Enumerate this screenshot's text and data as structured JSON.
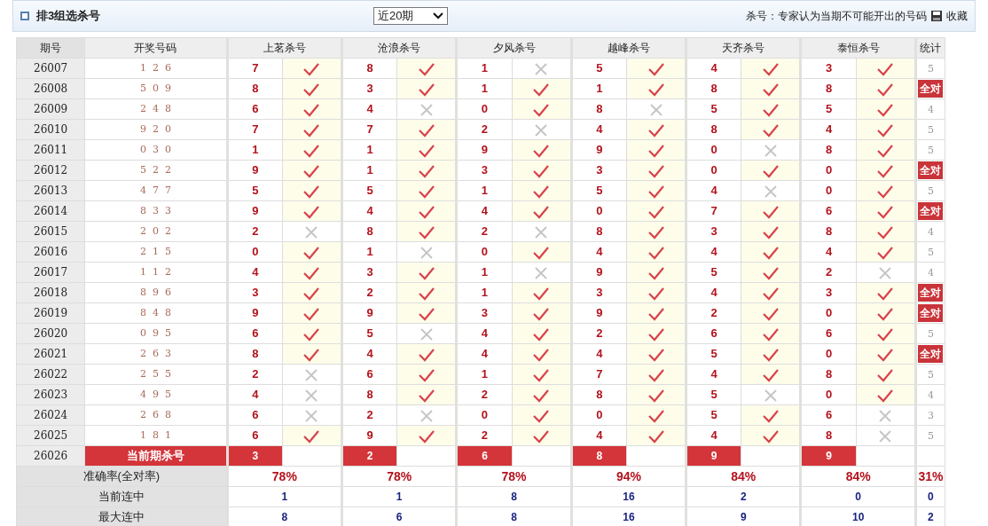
{
  "header": {
    "title": "排3组选杀号",
    "period_select": "近20期",
    "note": "杀号：专家认为当期不可能开出的号码",
    "save": "收藏"
  },
  "columns": {
    "period": "期号",
    "draw": "开奖号码",
    "experts": [
      "上茗杀号",
      "沧浪杀号",
      "夕风杀号",
      "越峰杀号",
      "天齐杀号",
      "泰恒杀号"
    ],
    "stat": "统计"
  },
  "rows": [
    {
      "period": "26007",
      "draw": "1 2 6",
      "picks": [
        {
          "num": "7",
          "hit": true
        },
        {
          "num": "8",
          "hit": true
        },
        {
          "num": "1",
          "hit": false
        },
        {
          "num": "5",
          "hit": true
        },
        {
          "num": "4",
          "hit": true
        },
        {
          "num": "3",
          "hit": true
        }
      ],
      "stat": {
        "kind": "count",
        "text": "5"
      }
    },
    {
      "period": "26008",
      "draw": "5 0 9",
      "picks": [
        {
          "num": "8",
          "hit": true
        },
        {
          "num": "3",
          "hit": true
        },
        {
          "num": "1",
          "hit": true
        },
        {
          "num": "1",
          "hit": true
        },
        {
          "num": "8",
          "hit": true
        },
        {
          "num": "8",
          "hit": true
        }
      ],
      "stat": {
        "kind": "all",
        "text": "全对"
      }
    },
    {
      "period": "26009",
      "draw": "2 4 8",
      "picks": [
        {
          "num": "6",
          "hit": true
        },
        {
          "num": "4",
          "hit": false
        },
        {
          "num": "0",
          "hit": true
        },
        {
          "num": "8",
          "hit": false
        },
        {
          "num": "5",
          "hit": true
        },
        {
          "num": "5",
          "hit": true
        }
      ],
      "stat": {
        "kind": "count",
        "text": "4"
      }
    },
    {
      "period": "26010",
      "draw": "9 2 0",
      "picks": [
        {
          "num": "7",
          "hit": true
        },
        {
          "num": "7",
          "hit": true
        },
        {
          "num": "2",
          "hit": false
        },
        {
          "num": "4",
          "hit": true
        },
        {
          "num": "8",
          "hit": true
        },
        {
          "num": "4",
          "hit": true
        }
      ],
      "stat": {
        "kind": "count",
        "text": "5"
      }
    },
    {
      "period": "26011",
      "draw": "0 3 0",
      "picks": [
        {
          "num": "1",
          "hit": true
        },
        {
          "num": "1",
          "hit": true
        },
        {
          "num": "9",
          "hit": true
        },
        {
          "num": "9",
          "hit": true
        },
        {
          "num": "0",
          "hit": false
        },
        {
          "num": "8",
          "hit": true
        }
      ],
      "stat": {
        "kind": "count",
        "text": "5"
      }
    },
    {
      "period": "26012",
      "draw": "5 2 2",
      "picks": [
        {
          "num": "9",
          "hit": true
        },
        {
          "num": "1",
          "hit": true
        },
        {
          "num": "3",
          "hit": true
        },
        {
          "num": "3",
          "hit": true
        },
        {
          "num": "0",
          "hit": true
        },
        {
          "num": "0",
          "hit": true
        }
      ],
      "stat": {
        "kind": "all",
        "text": "全对"
      }
    },
    {
      "period": "26013",
      "draw": "4 7 7",
      "picks": [
        {
          "num": "5",
          "hit": true
        },
        {
          "num": "5",
          "hit": true
        },
        {
          "num": "1",
          "hit": true
        },
        {
          "num": "5",
          "hit": true
        },
        {
          "num": "4",
          "hit": false
        },
        {
          "num": "0",
          "hit": true
        }
      ],
      "stat": {
        "kind": "count",
        "text": "5"
      }
    },
    {
      "period": "26014",
      "draw": "8 3 3",
      "picks": [
        {
          "num": "9",
          "hit": true
        },
        {
          "num": "4",
          "hit": true
        },
        {
          "num": "4",
          "hit": true
        },
        {
          "num": "0",
          "hit": true
        },
        {
          "num": "7",
          "hit": true
        },
        {
          "num": "6",
          "hit": true
        }
      ],
      "stat": {
        "kind": "all",
        "text": "全对"
      }
    },
    {
      "period": "26015",
      "draw": "2 0 2",
      "picks": [
        {
          "num": "2",
          "hit": false
        },
        {
          "num": "8",
          "hit": true
        },
        {
          "num": "2",
          "hit": false
        },
        {
          "num": "8",
          "hit": true
        },
        {
          "num": "3",
          "hit": true
        },
        {
          "num": "8",
          "hit": true
        }
      ],
      "stat": {
        "kind": "count",
        "text": "4"
      }
    },
    {
      "period": "26016",
      "draw": "2 1 5",
      "picks": [
        {
          "num": "0",
          "hit": true
        },
        {
          "num": "1",
          "hit": false
        },
        {
          "num": "0",
          "hit": true
        },
        {
          "num": "4",
          "hit": true
        },
        {
          "num": "4",
          "hit": true
        },
        {
          "num": "4",
          "hit": true
        }
      ],
      "stat": {
        "kind": "count",
        "text": "5"
      }
    },
    {
      "period": "26017",
      "draw": "1 1 2",
      "picks": [
        {
          "num": "4",
          "hit": true
        },
        {
          "num": "3",
          "hit": true
        },
        {
          "num": "1",
          "hit": false
        },
        {
          "num": "9",
          "hit": true
        },
        {
          "num": "5",
          "hit": true
        },
        {
          "num": "2",
          "hit": false
        }
      ],
      "stat": {
        "kind": "count",
        "text": "4"
      }
    },
    {
      "period": "26018",
      "draw": "8 9 6",
      "picks": [
        {
          "num": "3",
          "hit": true
        },
        {
          "num": "2",
          "hit": true
        },
        {
          "num": "1",
          "hit": true
        },
        {
          "num": "3",
          "hit": true
        },
        {
          "num": "4",
          "hit": true
        },
        {
          "num": "3",
          "hit": true
        }
      ],
      "stat": {
        "kind": "all",
        "text": "全对"
      }
    },
    {
      "period": "26019",
      "draw": "8 4 8",
      "picks": [
        {
          "num": "9",
          "hit": true
        },
        {
          "num": "9",
          "hit": true
        },
        {
          "num": "3",
          "hit": true
        },
        {
          "num": "9",
          "hit": true
        },
        {
          "num": "2",
          "hit": true
        },
        {
          "num": "0",
          "hit": true
        }
      ],
      "stat": {
        "kind": "all",
        "text": "全对"
      }
    },
    {
      "period": "26020",
      "draw": "0 9 5",
      "picks": [
        {
          "num": "6",
          "hit": true
        },
        {
          "num": "5",
          "hit": false
        },
        {
          "num": "4",
          "hit": true
        },
        {
          "num": "2",
          "hit": true
        },
        {
          "num": "6",
          "hit": true
        },
        {
          "num": "6",
          "hit": true
        }
      ],
      "stat": {
        "kind": "count",
        "text": "5"
      }
    },
    {
      "period": "26021",
      "draw": "2 6 3",
      "picks": [
        {
          "num": "8",
          "hit": true
        },
        {
          "num": "4",
          "hit": true
        },
        {
          "num": "4",
          "hit": true
        },
        {
          "num": "4",
          "hit": true
        },
        {
          "num": "5",
          "hit": true
        },
        {
          "num": "0",
          "hit": true
        }
      ],
      "stat": {
        "kind": "all",
        "text": "全对"
      }
    },
    {
      "period": "26022",
      "draw": "2 5 5",
      "picks": [
        {
          "num": "2",
          "hit": false
        },
        {
          "num": "6",
          "hit": true
        },
        {
          "num": "1",
          "hit": true
        },
        {
          "num": "7",
          "hit": true
        },
        {
          "num": "4",
          "hit": true
        },
        {
          "num": "8",
          "hit": true
        }
      ],
      "stat": {
        "kind": "count",
        "text": "5"
      }
    },
    {
      "period": "26023",
      "draw": "4 9 5",
      "picks": [
        {
          "num": "4",
          "hit": false
        },
        {
          "num": "8",
          "hit": true
        },
        {
          "num": "2",
          "hit": true
        },
        {
          "num": "8",
          "hit": true
        },
        {
          "num": "5",
          "hit": false
        },
        {
          "num": "0",
          "hit": true
        }
      ],
      "stat": {
        "kind": "count",
        "text": "4"
      }
    },
    {
      "period": "26024",
      "draw": "2 6 8",
      "picks": [
        {
          "num": "6",
          "hit": false
        },
        {
          "num": "2",
          "hit": false
        },
        {
          "num": "0",
          "hit": true
        },
        {
          "num": "0",
          "hit": true
        },
        {
          "num": "5",
          "hit": true
        },
        {
          "num": "6",
          "hit": false
        }
      ],
      "stat": {
        "kind": "count",
        "text": "3"
      }
    },
    {
      "period": "26025",
      "draw": "1 8 1",
      "picks": [
        {
          "num": "6",
          "hit": true
        },
        {
          "num": "9",
          "hit": true
        },
        {
          "num": "2",
          "hit": true
        },
        {
          "num": "4",
          "hit": true
        },
        {
          "num": "4",
          "hit": true
        },
        {
          "num": "8",
          "hit": false
        }
      ],
      "stat": {
        "kind": "count",
        "text": "5"
      }
    }
  ],
  "current": {
    "period": "26026",
    "label": "当前期杀号",
    "nums": [
      "3",
      "2",
      "6",
      "8",
      "9",
      "9"
    ]
  },
  "summary": [
    {
      "kind": "rate",
      "label": "准确率(全对率)",
      "values": [
        "78%",
        "78%",
        "78%",
        "94%",
        "84%",
        "84%"
      ],
      "stat": "31%"
    },
    {
      "kind": "streak",
      "label": "当前连中",
      "values": [
        "1",
        "1",
        "8",
        "16",
        "2",
        "0"
      ],
      "stat": "0"
    },
    {
      "kind": "streak",
      "label": "最大连中",
      "values": [
        "8",
        "6",
        "8",
        "16",
        "9",
        "10"
      ],
      "stat": "2"
    }
  ]
}
